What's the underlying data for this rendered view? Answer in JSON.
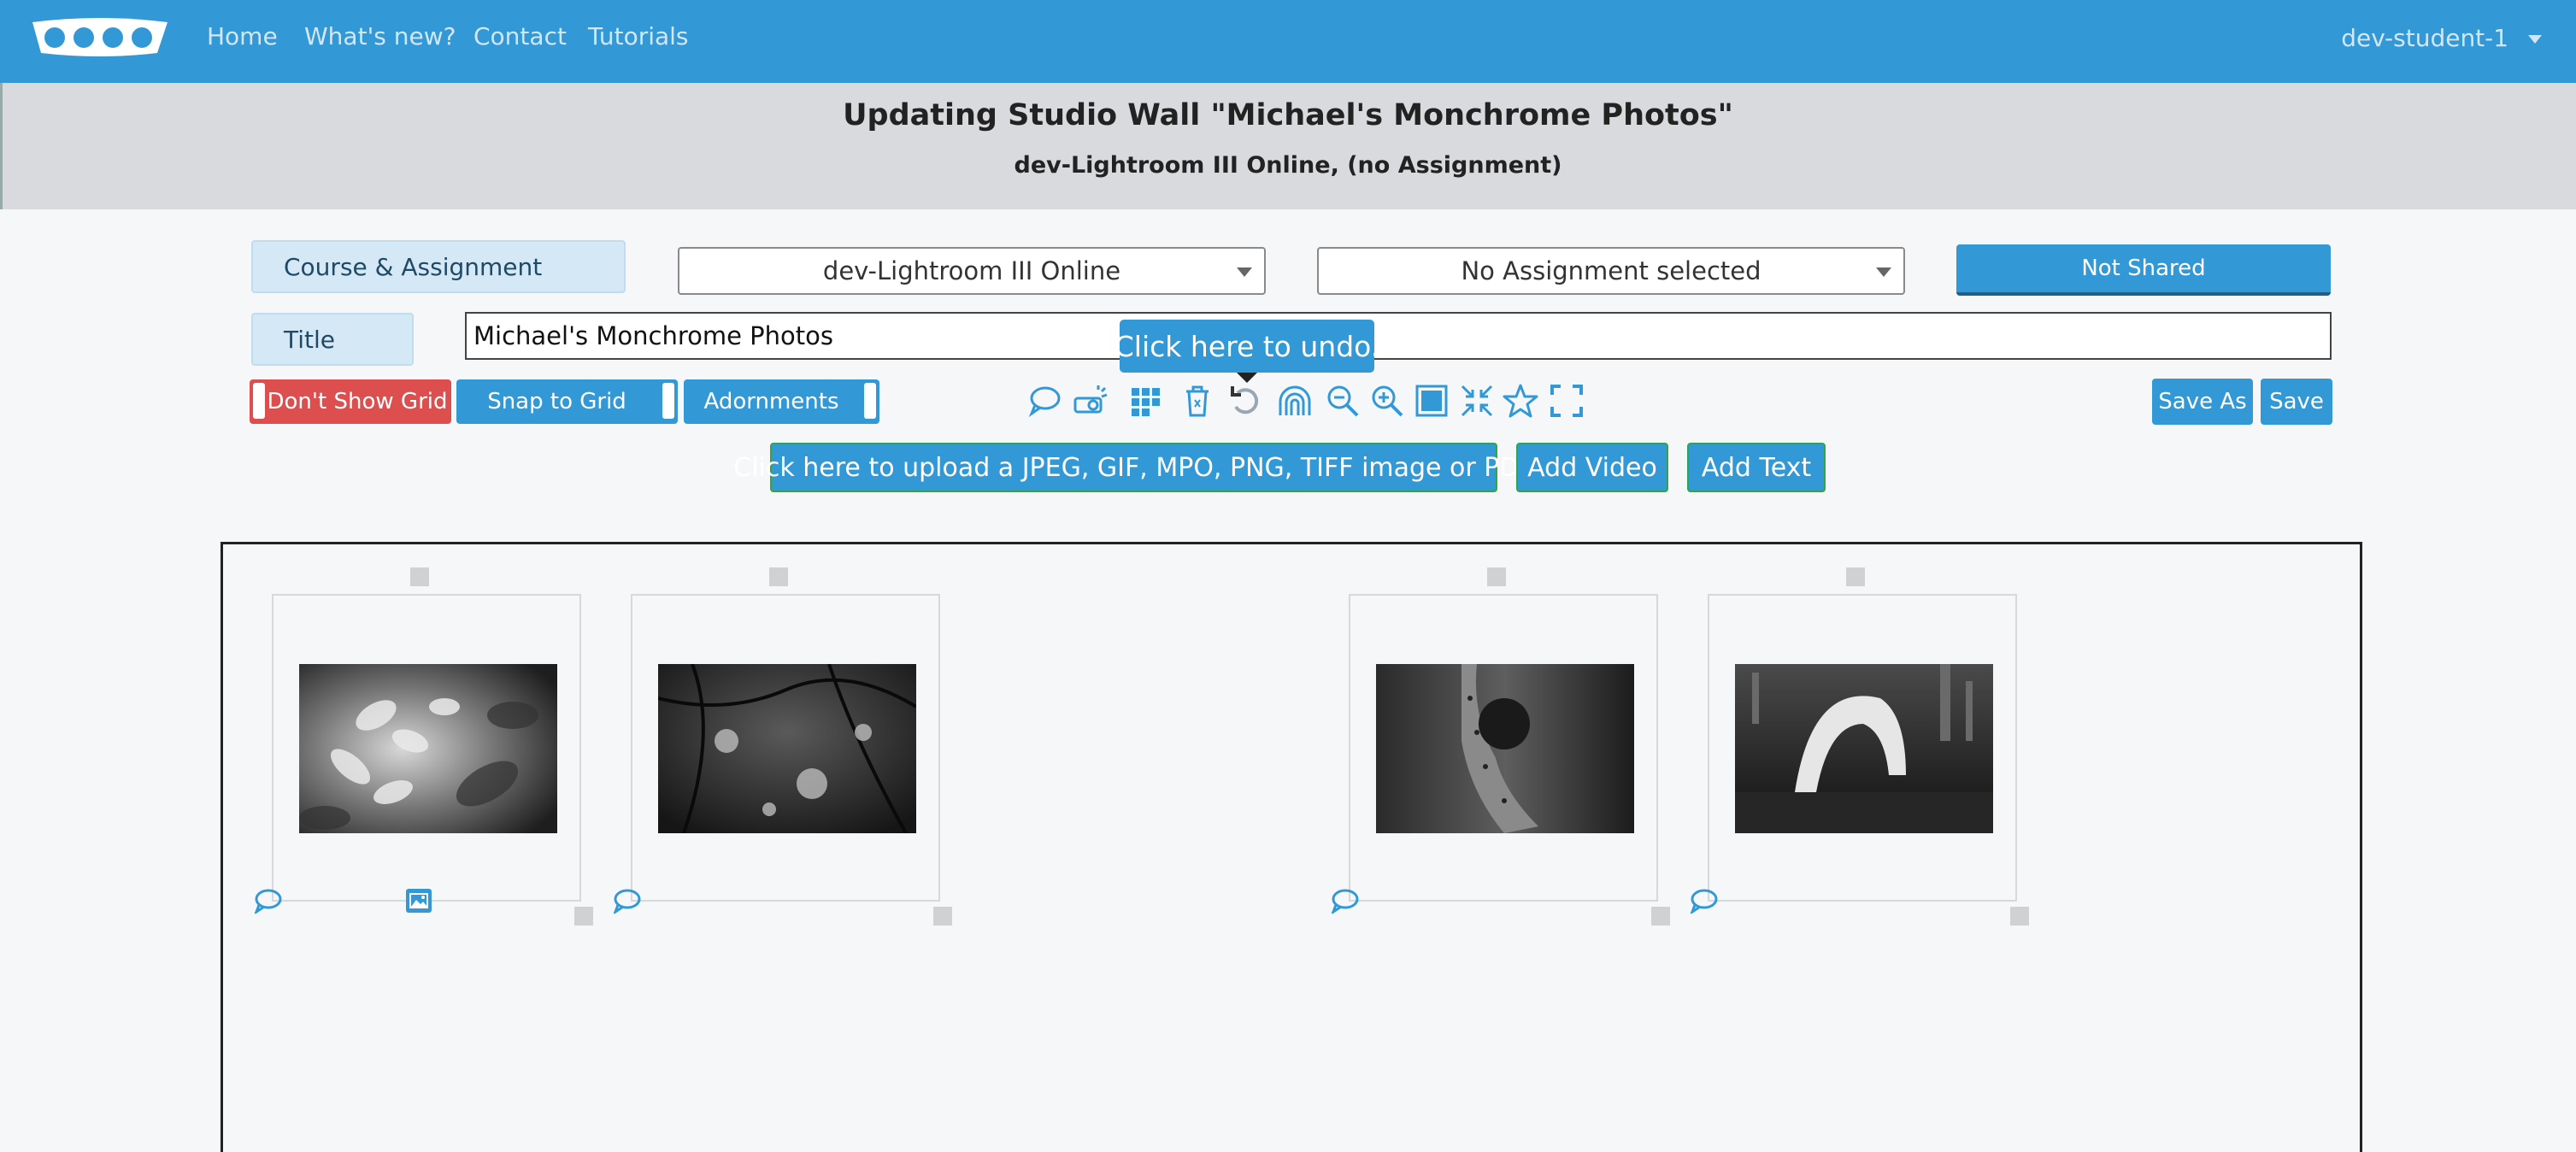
{
  "nav": {
    "logo": "logo",
    "links": [
      "Home",
      "What's new?",
      "Contact",
      "Tutorials"
    ],
    "user": "dev-student-1"
  },
  "header": {
    "title": "Updating Studio Wall \"Michael's Monchrome Photos\"",
    "subtitle": "dev-Lightroom III Online, (no Assignment)"
  },
  "form": {
    "course_label": "Course & Assignment",
    "course_value": "dev-Lightroom III Online",
    "assignment_value": "No Assignment selected",
    "share_button": "Not Shared",
    "title_label": "Title",
    "title_value": "Michael's Monchrome Photos"
  },
  "controls": {
    "grid_button": "Don't Show Grid",
    "snap_button": "Snap to Grid",
    "adornments_button": "Adornments",
    "save_as": "Save As",
    "save": "Save",
    "tooltip": "Click here to undo."
  },
  "toolbar_icons": [
    "comment-icon",
    "projector-icon",
    "grid-icon",
    "trash-icon",
    "undo-icon",
    "arch-icon",
    "zoom-out-icon",
    "zoom-in-icon",
    "square-icon",
    "shrink-icon",
    "star-icon",
    "fullscreen-icon"
  ],
  "upload": {
    "image_button": "Click here to upload a JPEG, GIF, MPO, PNG, TIFF image or PDF",
    "video_button": "Add Video",
    "text_button": "Add Text"
  },
  "colors": {
    "brand": "#3399d6",
    "danger": "#dd4f4f",
    "upload_border": "#2fa64b"
  },
  "wall": {
    "items": [
      {
        "name": "photo-flowers"
      },
      {
        "name": "photo-branches"
      },
      {
        "name": "photo-lizard"
      },
      {
        "name": "photo-fountain"
      }
    ]
  }
}
